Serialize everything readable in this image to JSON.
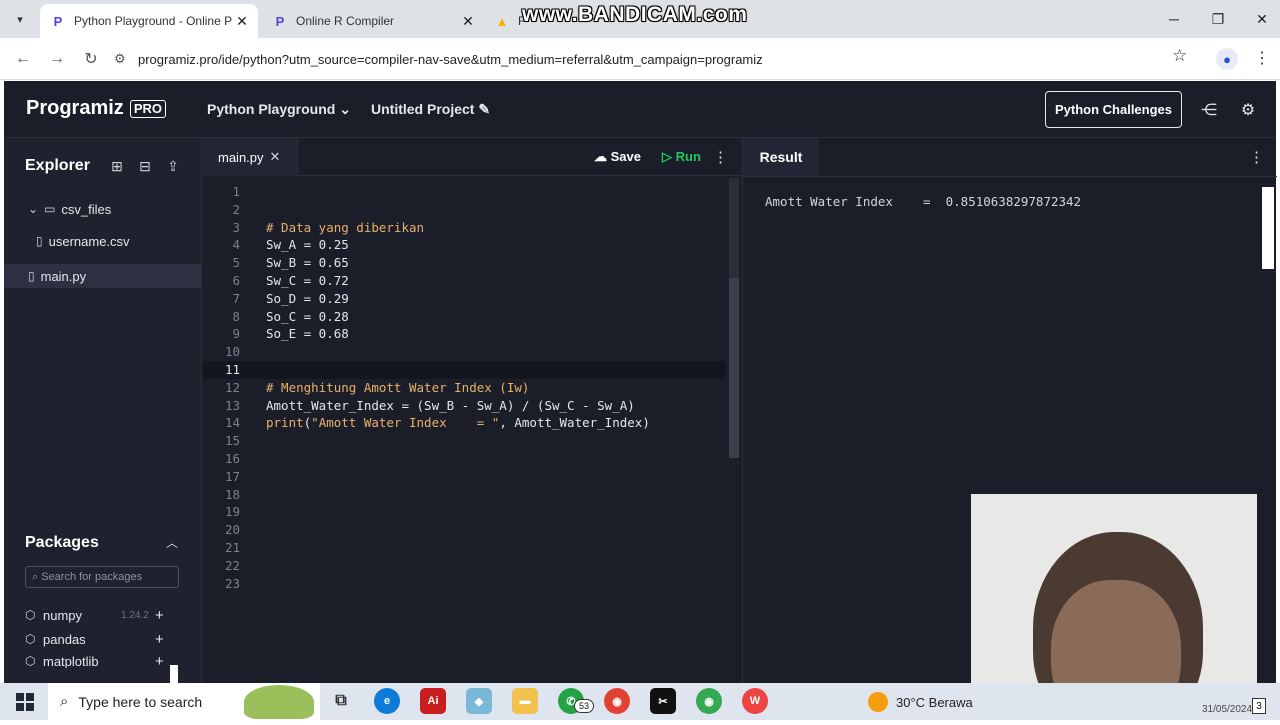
{
  "browser": {
    "tabs": [
      {
        "title": "Python Playground - Online Py",
        "favicon": "P",
        "active": true
      },
      {
        "title": "Online R Compiler",
        "favicon": "P",
        "active": false
      },
      {
        "title": "F",
        "favicon": "drive",
        "active": false
      }
    ],
    "watermark": "www.BANDICAM.com",
    "url": "programiz.pro/ide/python?utm_source=compiler-nav-save&utm_medium=referral&utm_campaign=programiz"
  },
  "app": {
    "logo": "Programiz",
    "logo_badge": "PRO",
    "nav": {
      "playground": "Python Playground",
      "project": "Untitled Project"
    },
    "challenges_button": "Python Challenges"
  },
  "explorer": {
    "title": "Explorer",
    "tree": [
      {
        "name": "csv_files",
        "type": "folder",
        "expanded": true
      },
      {
        "name": "username.csv",
        "type": "file"
      },
      {
        "name": "main.py",
        "type": "file",
        "selected": true
      }
    ]
  },
  "packages": {
    "title": "Packages",
    "search_placeholder": "Search for packages",
    "items": [
      {
        "name": "numpy",
        "version": "1.24.2"
      },
      {
        "name": "pandas",
        "version": ""
      },
      {
        "name": "matplotlib",
        "version": ""
      }
    ]
  },
  "editor": {
    "tab": "main.py",
    "save_label": "Save",
    "run_label": "Run",
    "lines": [
      "",
      "",
      "# Data yang diberikan",
      "Sw_A = 0.25",
      "Sw_B = 0.65",
      "Sw_C = 0.72",
      "So_D = 0.29",
      "So_C = 0.28",
      "So_E = 0.68",
      "",
      "",
      "# Menghitung Amott Water Index (Iw)",
      "Amott_Water_Index = (Sw_B - Sw_A) / (Sw_C - Sw_A)",
      "print(\"Amott Water Index    = \", Amott_Water_Index)",
      "",
      "",
      "",
      "",
      "",
      "",
      "",
      "",
      ""
    ],
    "active_line": 11
  },
  "result": {
    "title": "Result",
    "output": "Amott Water Index    =  0.8510638297872342"
  },
  "taskbar": {
    "search_placeholder": "Type here to search",
    "whatsapp_badge": "53",
    "weather": "30°C  Berawa",
    "date": "31/05/2024",
    "notifications": "3"
  },
  "colors": {
    "app_bg": "#1b1e29",
    "run_green": "#22c55e",
    "comment": "#e8b06a"
  }
}
